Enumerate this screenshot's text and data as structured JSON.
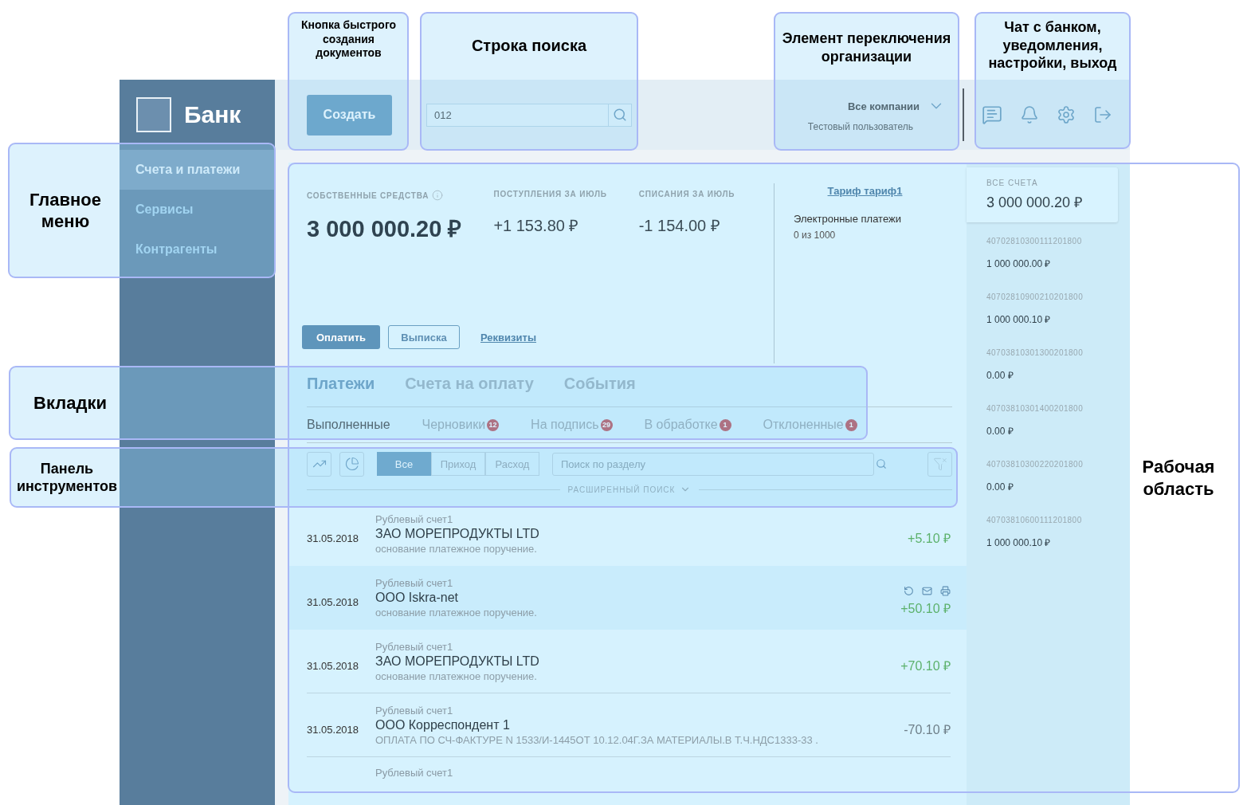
{
  "sidebar": {
    "logo": "Банк",
    "items": [
      {
        "label": "Счета и платежи",
        "selected": true
      },
      {
        "label": "Сервисы",
        "selected": false
      },
      {
        "label": "Контрагенты",
        "selected": false
      }
    ]
  },
  "header": {
    "create_button": "Создать",
    "search": {
      "value": "012"
    },
    "organization": {
      "name": "Все компании",
      "user": "Тестовый пользователь"
    }
  },
  "summary": {
    "own_funds": {
      "label": "СОБСТВЕННЫЕ СРЕДСТВА",
      "value": "3 000 000.20 ₽"
    },
    "income": {
      "label": "ПОСТУПЛЕНИЯ ЗА ИЮЛЬ",
      "value": "+1 153.80 ₽"
    },
    "expense": {
      "label": "СПИСАНИЯ ЗА ИЮЛЬ",
      "value": "-1 154.00 ₽"
    },
    "buttons": {
      "pay": "Оплатить",
      "statement": "Выписка",
      "details": "Реквизиты"
    },
    "tariff": {
      "link": "Тариф тариф1",
      "name": "Электронные платежи",
      "usage": "0 из 1000"
    }
  },
  "tabs": [
    {
      "label": "Платежи",
      "selected": true
    },
    {
      "label": "Счета на оплату",
      "selected": false
    },
    {
      "label": "События",
      "selected": false
    }
  ],
  "subtabs": [
    {
      "label": "Выполненные",
      "selected": true
    },
    {
      "label": "Черновики",
      "selected": false,
      "badge": "12"
    },
    {
      "label": "На подпись",
      "selected": false,
      "badge": "29"
    },
    {
      "label": "В обработке",
      "selected": false,
      "badge": "1"
    },
    {
      "label": "Отклоненные",
      "selected": false,
      "badge": "1"
    }
  ],
  "toolbar": {
    "filters": [
      {
        "label": "Все",
        "selected": true
      },
      {
        "label": "Приход",
        "selected": false
      },
      {
        "label": "Расход",
        "selected": false
      }
    ],
    "search": {
      "placeholder": "Поиск по разделу"
    },
    "advanced_search": "РАСШИРЕННЫЙ ПОИСК"
  },
  "transactions": [
    {
      "account": "Рублевый счет1",
      "date": "31.05.2018",
      "name": "ЗАО МОРЕПРОДУКТЫ LTD",
      "purpose": "основание платежное поручение.",
      "amount": "+5.10 ₽",
      "kind": "income",
      "highlighted": false
    },
    {
      "account": "Рублевый счет1",
      "date": "31.05.2018",
      "name": "ООО Iskra-net",
      "purpose": "основание платежное поручение.",
      "amount": "+50.10 ₽",
      "kind": "income",
      "highlighted": true
    },
    {
      "account": "Рублевый счет1",
      "date": "31.05.2018",
      "name": "ЗАО МОРЕПРОДУКТЫ LTD",
      "purpose": "основание платежное поручение.",
      "amount": "+70.10 ₽",
      "kind": "income",
      "highlighted": false
    },
    {
      "account": "Рублевый счет1",
      "date": "31.05.2018",
      "name": "ООО Корреспондент 1",
      "purpose": "ОПЛАТА ПО СЧ-ФАКТУРЕ N 1533/И-1445ОТ 10.12.04Г.ЗА МАТЕРИАЛЫ.В Т.Ч.НДС1333-33 .",
      "amount": "-70.10 ₽",
      "kind": "expense",
      "highlighted": false
    },
    {
      "account": "Рублевый счет1",
      "kind": "partial",
      "highlighted": false
    }
  ],
  "accounts": {
    "total": {
      "label": "ВСЕ СЧЕТА",
      "value": "3 000 000.20 ₽",
      "selected": true
    },
    "items": [
      {
        "number": "40702810300111201800",
        "balance": "1 000 000.00 ₽"
      },
      {
        "number": "40702810900210201800",
        "balance": "1 000 000.10 ₽"
      },
      {
        "number": "40703810301300201800",
        "balance": "0.00 ₽"
      },
      {
        "number": "40703810301400201800",
        "balance": "0.00 ₽"
      },
      {
        "number": "40703810300220201800",
        "balance": "0.00 ₽"
      },
      {
        "number": "40703810600111201800",
        "balance": "1 000 000.10 ₽"
      }
    ]
  },
  "annotations": [
    "Кнопка быстрого создания документов",
    "Строка поиска",
    "Элемент переключения организации",
    "Чат с банком, уведомления, настройки, выход",
    "Главное меню",
    "Вкладки",
    "Панель инструментов",
    "Рабочая область"
  ]
}
